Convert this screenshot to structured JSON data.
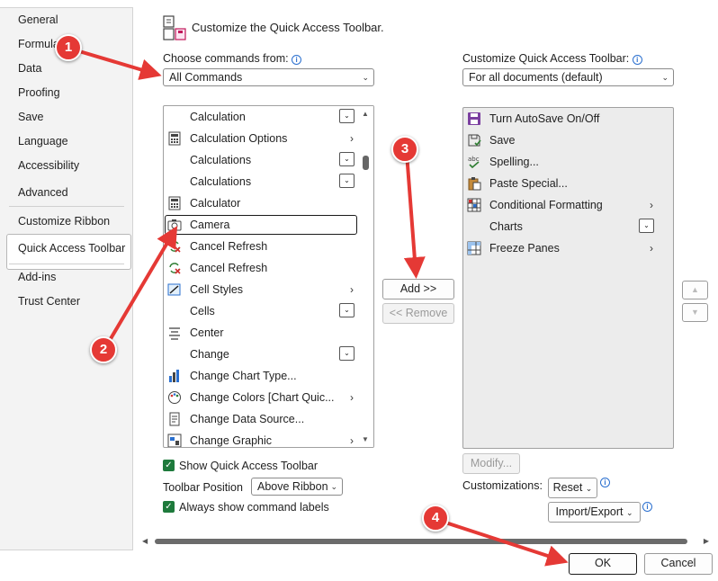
{
  "nav": {
    "items": [
      "General",
      "Formulas",
      "Data",
      "Proofing",
      "Save",
      "Language",
      "Accessibility",
      "Advanced",
      "Customize Ribbon",
      "Quick Access Toolbar",
      "Add-ins",
      "Trust Center"
    ],
    "selected": "Quick Access Toolbar"
  },
  "header": {
    "title": "Customize the Quick Access Toolbar."
  },
  "left_panel": {
    "label": "Choose commands from:",
    "combo_value": "All Commands",
    "commands": [
      {
        "label": "Calculation",
        "icon": "none",
        "suffix": "dropdown"
      },
      {
        "label": "Calculation Options",
        "icon": "calculator-grid-icon",
        "suffix": "submenu"
      },
      {
        "label": "Calculations",
        "icon": "none",
        "suffix": "dropdown"
      },
      {
        "label": "Calculations",
        "icon": "none",
        "suffix": "dropdown"
      },
      {
        "label": "Calculator",
        "icon": "calculator-icon",
        "suffix": "none"
      },
      {
        "label": "Camera",
        "icon": "camera-icon",
        "suffix": "none"
      },
      {
        "label": "Cancel Refresh",
        "icon": "cancel-refresh-icon",
        "suffix": "none"
      },
      {
        "label": "Cancel Refresh",
        "icon": "cancel-refresh-icon",
        "suffix": "none"
      },
      {
        "label": "Cell Styles",
        "icon": "cell-styles-icon",
        "suffix": "submenu"
      },
      {
        "label": "Cells",
        "icon": "none",
        "suffix": "dropdown"
      },
      {
        "label": "Center",
        "icon": "center-align-icon",
        "suffix": "none"
      },
      {
        "label": "Change",
        "icon": "none",
        "suffix": "dropdown"
      },
      {
        "label": "Change Chart Type...",
        "icon": "chart-type-icon",
        "suffix": "none"
      },
      {
        "label": "Change Colors [Chart Quic...",
        "icon": "palette-icon",
        "suffix": "submenu"
      },
      {
        "label": "Change Data Source...",
        "icon": "data-source-icon",
        "suffix": "none"
      },
      {
        "label": "Change Graphic",
        "icon": "graphic-icon",
        "suffix": "submenu"
      }
    ],
    "selected_index": 5
  },
  "right_panel": {
    "label": "Customize Quick Access Toolbar:",
    "combo_value": "For all documents (default)",
    "commands": [
      {
        "label": "Turn AutoSave On/Off",
        "icon": "autosave-icon",
        "suffix": "none"
      },
      {
        "label": "Save",
        "icon": "save-icon",
        "suffix": "none"
      },
      {
        "label": "Spelling...",
        "icon": "spelling-icon",
        "suffix": "none"
      },
      {
        "label": "Paste Special...",
        "icon": "paste-icon",
        "suffix": "none"
      },
      {
        "label": "Conditional Formatting",
        "icon": "conditional-formatting-icon",
        "suffix": "submenu"
      },
      {
        "label": "Charts",
        "icon": "none",
        "suffix": "dropdown"
      },
      {
        "label": "Freeze Panes",
        "icon": "freeze-panes-icon",
        "suffix": "submenu"
      }
    ]
  },
  "buttons": {
    "add": "Add >>",
    "remove": "<< Remove",
    "modify": "Modify...",
    "reset": "Reset",
    "import_export": "Import/Export",
    "ok": "OK",
    "cancel": "Cancel"
  },
  "options": {
    "show_qat": "Show Quick Access Toolbar",
    "toolbar_position_label": "Toolbar Position",
    "toolbar_position_value": "Above Ribbon",
    "always_show_labels": "Always show command labels",
    "customizations_label": "Customizations:"
  },
  "annotations": [
    "1",
    "2",
    "3",
    "4"
  ],
  "colors": {
    "accent": "#1e7a3c",
    "marker": "#e53935",
    "arrow": "#e53935"
  }
}
